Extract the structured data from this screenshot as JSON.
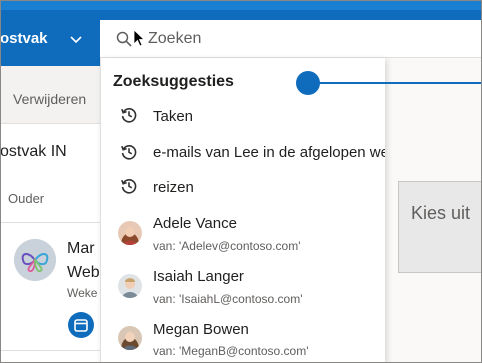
{
  "header": {
    "folder_label": "ostvak",
    "search_placeholder": "Zoeken"
  },
  "mail_list": {
    "delete_label": "Verwijderen",
    "folder_title": "ostvak IN",
    "sort_label": "Ouder",
    "message": {
      "sender": "Mar",
      "subject": "Web",
      "preview": "Weke"
    }
  },
  "reading_pane": {
    "choose_label": "Kies uit"
  },
  "suggestions": {
    "heading": "Zoeksuggesties",
    "terms": [
      {
        "label": "Taken",
        "icon": "history-icon"
      },
      {
        "label": "e-mails van Lee in de afgelopen week",
        "icon": "history-icon"
      },
      {
        "label": "reizen",
        "icon": "history-icon"
      }
    ],
    "people": [
      {
        "name": "Adele Vance",
        "email": "van: 'Adelev@contoso.com'"
      },
      {
        "name": "Isaiah Langer",
        "email": "van: 'IsaiahL@contoso.com'"
      },
      {
        "name": "Megan Bowen",
        "email": "van: 'MeganB@contoso.com'"
      }
    ]
  },
  "colors": {
    "brand": "#0f6cbd",
    "text": "#201f1e",
    "muted": "#605e5c"
  }
}
